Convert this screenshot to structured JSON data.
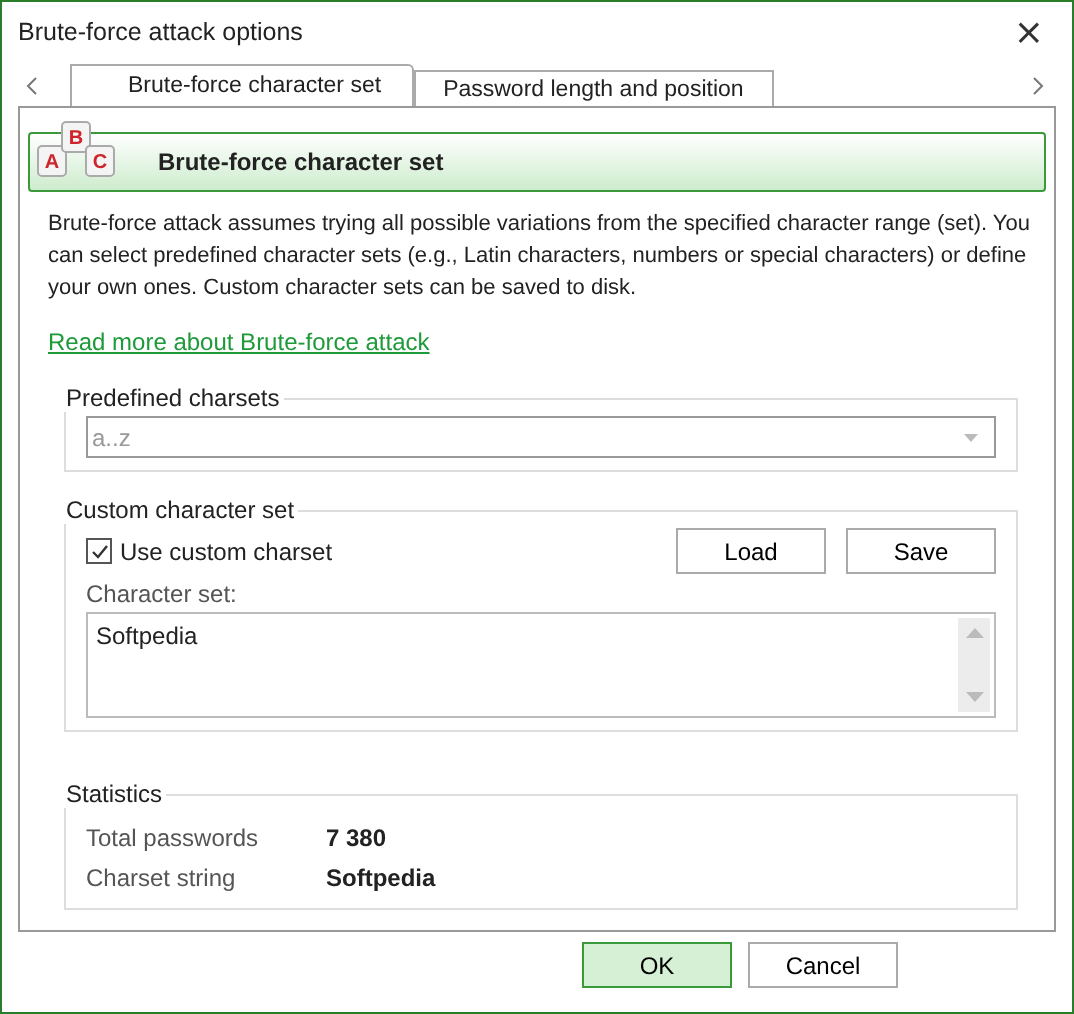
{
  "window": {
    "title": "Brute-force attack options",
    "close": "×"
  },
  "tabs": [
    {
      "label": "Brute-force character set",
      "selected": true
    },
    {
      "label": "Password length and position",
      "selected": false
    }
  ],
  "header": {
    "title": "Brute-force character set",
    "icon_keys": [
      "A",
      "B",
      "C"
    ]
  },
  "description": "Brute-force attack assumes trying all possible variations from the specified character range (set). You can select predefined character sets (e.g., Latin characters, numbers or special characters) or define your own ones. Custom character sets can be saved to disk.",
  "link": "Read more about Brute-force attack",
  "predefined": {
    "title": "Predefined charsets",
    "value": "a..z",
    "disabled": true
  },
  "custom": {
    "title": "Custom character set",
    "checkbox": {
      "label": "Use custom charset",
      "checked": true
    },
    "buttons": [
      "Load",
      "Save"
    ],
    "field_label": "Character set:",
    "value": "Softpedia"
  },
  "statistics": {
    "title": "Statistics",
    "rows": [
      {
        "label": "Total passwords",
        "value": "7 380"
      },
      {
        "label": "Charset string",
        "value": "Softpedia"
      }
    ]
  },
  "buttons": [
    {
      "label": "OK",
      "kind": "primary"
    },
    {
      "label": "Cancel",
      "kind": "normal"
    }
  ]
}
